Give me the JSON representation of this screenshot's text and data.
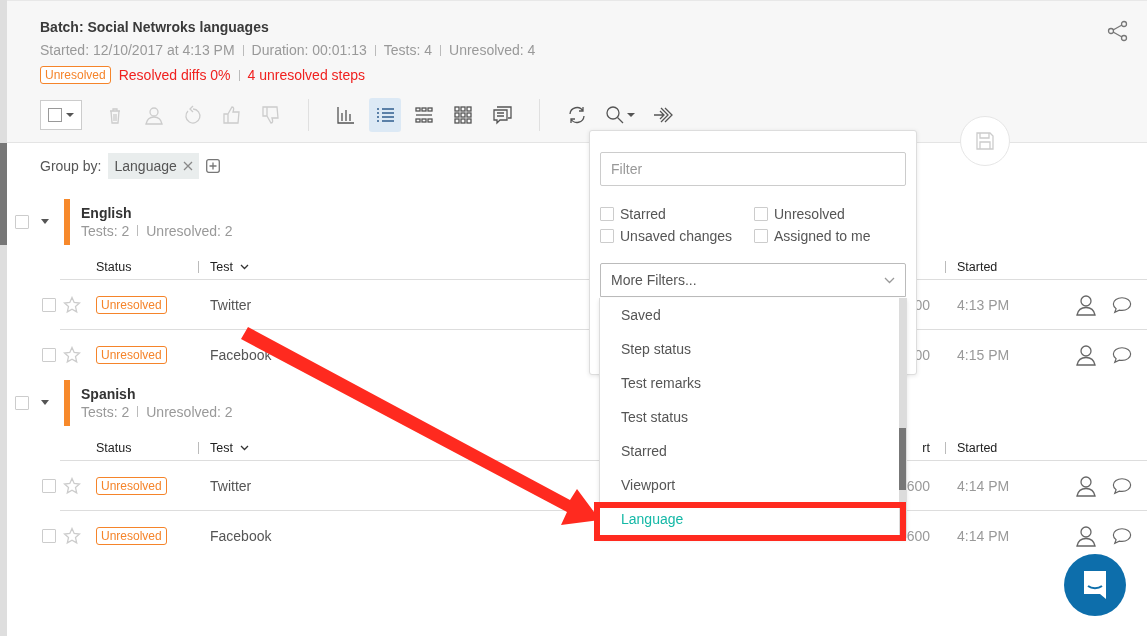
{
  "batch": {
    "title": "Batch: Social Netwroks languages",
    "meta": [
      "Started: 12/10/2017 at 4:13 PM",
      "Duration: 00:01:13",
      "Tests: 4",
      "Unresolved: 4"
    ],
    "status_badge": "Unresolved",
    "summary": [
      "Resolved diffs 0%",
      "4 unresolved steps"
    ]
  },
  "toolbar": {
    "select_all": {
      "checked": false
    },
    "actions": [
      {
        "kind": "delete",
        "disabled": true
      },
      {
        "kind": "assign",
        "disabled": true
      },
      {
        "kind": "revert",
        "disabled": true
      },
      {
        "kind": "accept",
        "disabled": true
      },
      {
        "kind": "reject",
        "disabled": true
      }
    ],
    "view_modes": [
      {
        "kind": "chart",
        "selected": false
      },
      {
        "kind": "list",
        "selected": true
      },
      {
        "kind": "grid-small",
        "selected": false
      },
      {
        "kind": "grid",
        "selected": false
      },
      {
        "kind": "comments",
        "selected": false
      }
    ],
    "tools": [
      {
        "kind": "refresh"
      },
      {
        "kind": "search"
      },
      {
        "kind": "forward"
      }
    ]
  },
  "group_by": {
    "label": "Group by:",
    "chips": [
      "Language"
    ]
  },
  "groups": [
    {
      "name": "English",
      "checked": false,
      "expanded": true,
      "summary": [
        "Tests: 2",
        "Unresolved: 2"
      ],
      "header": {
        "status": "Status",
        "test": "Test",
        "started": "Started"
      },
      "rows": [
        {
          "checked": false,
          "starred": false,
          "status": "Unresolved",
          "test": "Twitter",
          "column_5": "00",
          "started": "4:13 PM"
        },
        {
          "checked": false,
          "starred": false,
          "status": "Unresolved",
          "test": "Facebook",
          "column_5": "00",
          "started": "4:15 PM"
        }
      ]
    },
    {
      "name": "Spanish",
      "checked": false,
      "expanded": true,
      "summary": [
        "Tests: 2",
        "Unresolved: 2"
      ],
      "header": {
        "status": "Status",
        "test": "Test",
        "column_5": "rt",
        "started": "Started"
      },
      "rows": [
        {
          "checked": false,
          "starred": false,
          "status": "Unresolved",
          "test": "Twitter",
          "column_5": "600",
          "started": "4:14 PM"
        },
        {
          "checked": false,
          "starred": false,
          "status": "Unresolved",
          "test": "Facebook",
          "column_5": "600",
          "started": "4:14 PM"
        }
      ]
    }
  ],
  "filter_panel": {
    "placeholder": "Filter",
    "checkboxes": [
      {
        "label": "Starred",
        "checked": false
      },
      {
        "label": "Unresolved",
        "checked": false
      },
      {
        "label": "Unsaved changes",
        "checked": false
      },
      {
        "label": "Assigned to me",
        "checked": false
      }
    ],
    "more_filters": {
      "label": "More Filters...",
      "expanded": true,
      "options": [
        {
          "label": "Saved",
          "highlighted": false
        },
        {
          "label": "Step status",
          "highlighted": false
        },
        {
          "label": "Test remarks",
          "highlighted": false
        },
        {
          "label": "Test status",
          "highlighted": false
        },
        {
          "label": "Starred",
          "highlighted": false
        },
        {
          "label": "Viewport",
          "highlighted": false
        },
        {
          "label": "Language",
          "highlighted": true
        }
      ]
    }
  }
}
